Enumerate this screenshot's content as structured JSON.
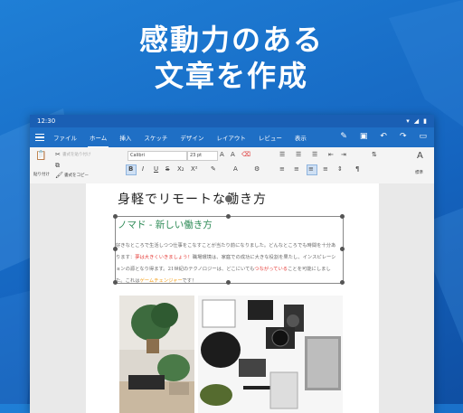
{
  "headline": {
    "line1": "感動力のある",
    "line2": "文章を作成"
  },
  "status": {
    "time": "12:30"
  },
  "menu": {
    "tabs": [
      "ファイル",
      "ホーム",
      "挿入",
      "スケッチ",
      "デザイン",
      "レイアウト",
      "レビュー",
      "表示"
    ],
    "active_tab": "ホーム"
  },
  "ribbon": {
    "paste_label": "貼り付け",
    "format_paste_label": "書式を貼り付け",
    "format_copy_label": "書式をコピー",
    "font_name": "Calibri",
    "font_size": "23 pt",
    "style_label": "標準"
  },
  "document": {
    "title": "身軽でリモートな働き方",
    "subtitle": "ノマド - 新しい働き方",
    "body_parts": [
      "好きなところで生活しつつ仕事をこなすことが当たり前になりました。どんなところでも時間を十分あります：",
      "夢は大きくいきましょう！",
      "職場環境は、家庭での成功に大きな役割を果たし、インスピレーションの源となり得ます。21世紀のテクノロジーは、どこにいても",
      "つながっている",
      "ことを可能にしました。これは",
      "ゲームチェンジャー",
      "です！"
    ]
  },
  "colors": {
    "accent": "#1f6fc5",
    "background": "#1565c0",
    "subtitle": "#2e8b57",
    "highlight_red": "#e53935",
    "highlight_orange": "#f39c12"
  }
}
